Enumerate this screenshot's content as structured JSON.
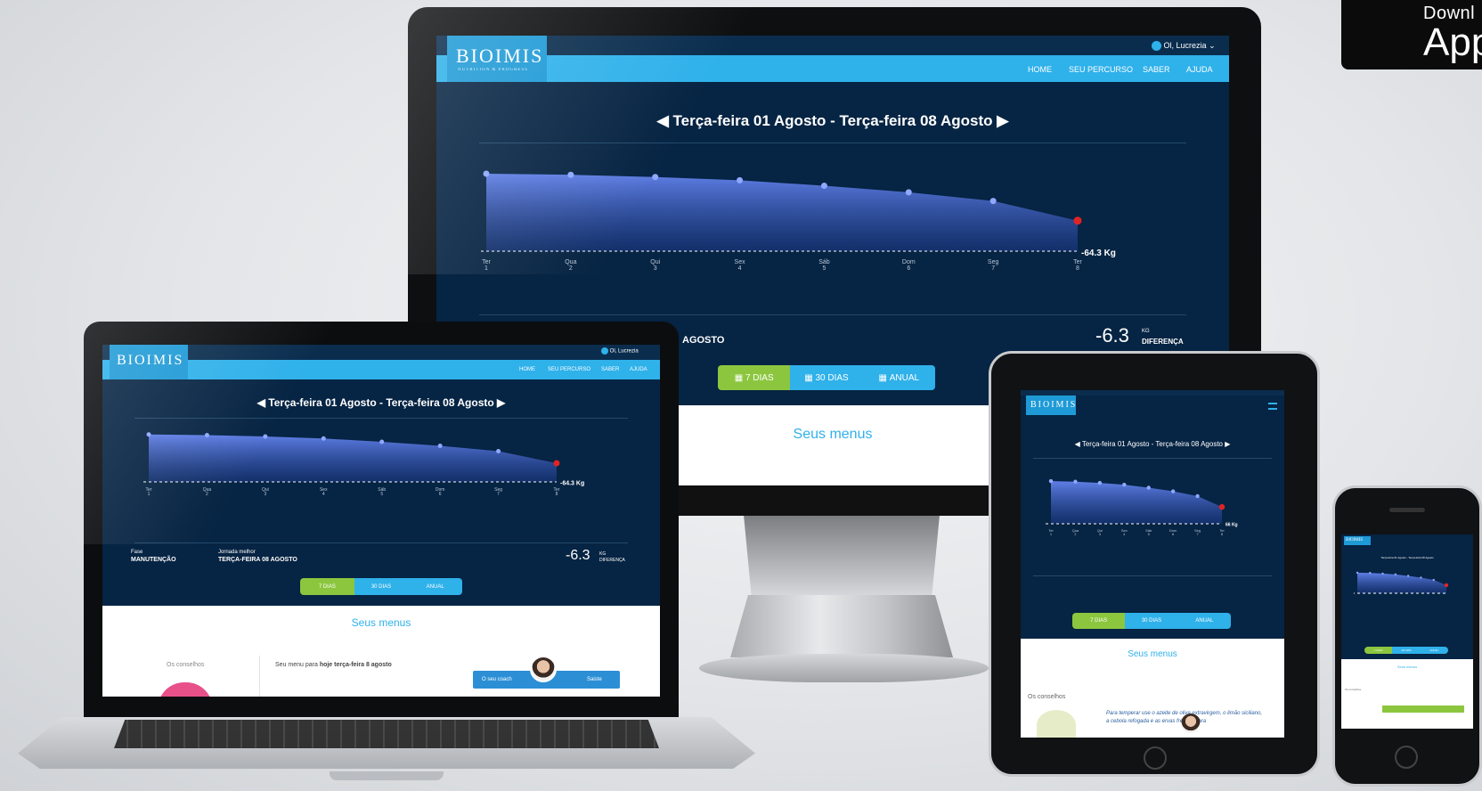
{
  "badge": {
    "line1": "Downl",
    "line2": "App"
  },
  "brand": "BIOIMIS",
  "brand_tagline": "NUTRITION & PROGRESS",
  "user_greeting": "Ol, Lucrezia",
  "nav": [
    "HOME",
    "SEU PERCURSO",
    "SABER",
    "AJUDA"
  ],
  "date_range": "Terça-feira 01 Agosto - Terça-feira 08 Agosto",
  "date_range_phone": "Terça-feira 01 Agosto - Terça-feira 08 Agosto",
  "weight_label": "-64.3 Kg",
  "weight_label_tablet": "66 Kg",
  "days": [
    {
      "d": "Ter",
      "n": "1"
    },
    {
      "d": "Qua",
      "n": "2"
    },
    {
      "d": "Qui",
      "n": "3"
    },
    {
      "d": "Sex",
      "n": "4"
    },
    {
      "d": "Sáb",
      "n": "5"
    },
    {
      "d": "Dom",
      "n": "6"
    },
    {
      "d": "Seg",
      "n": "7"
    },
    {
      "d": "Ter",
      "n": "8"
    }
  ],
  "phase": {
    "label": "Fase",
    "value": "MANUTENÇÃO"
  },
  "best_day": {
    "label": "Jornada melhor",
    "value": "TERÇA-FEIRA 08 AGOSTO"
  },
  "imac_best_day_partial": "AGOSTO",
  "difference": {
    "value": "-6.3",
    "unit": "KG",
    "label": "DIFERENÇA"
  },
  "tabs": [
    "7 DIAS",
    "30 DIAS",
    "ANUAL"
  ],
  "menus_title": "Seus menus",
  "advice_title": "Os conselhos",
  "menu_today_prefix": "Seu menu para ",
  "menu_today_bold": "hoje terça-feira 8 agosto",
  "coach_left": "O seu coach",
  "coach_right": "Saiste",
  "tablet_tip": "Para temperar use o azeite de oliva extravirgem, o limão siciliano, a cebola refogada e as ervas frescas para",
  "colors": {
    "navy": "#062443",
    "nav": "#2fb1ea",
    "green": "#8cc63f",
    "area_top": "#5f7fe6",
    "highlight": "#e02424"
  },
  "chart_data": {
    "type": "area",
    "categories": [
      "Ter 1",
      "Qua 2",
      "Qui 3",
      "Sex 4",
      "Sáb 5",
      "Dom 6",
      "Seg 7",
      "Ter 8"
    ],
    "series": [
      {
        "values": [
          70.6,
          70.5,
          70.3,
          70.0,
          69.5,
          68.9,
          68.1,
          66.3
        ]
      }
    ],
    "target_line": -64.3,
    "ylim": [
      63.5,
      71.5
    ],
    "highlight_last": true
  }
}
